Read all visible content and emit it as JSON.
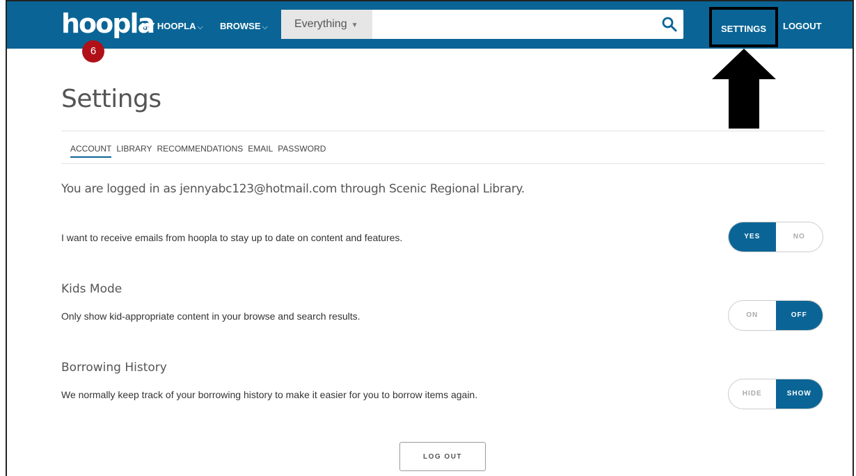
{
  "header": {
    "logo": "hoopla",
    "badge_count": "6",
    "my_hoopla": "MY HOOPLA",
    "browse": "BROWSE",
    "search": {
      "filter": "Everything",
      "placeholder": ""
    },
    "settings": "SETTINGS",
    "logout": "LOGOUT"
  },
  "page": {
    "title": "Settings",
    "tabs": [
      {
        "label": "ACCOUNT",
        "active": true
      },
      {
        "label": "LIBRARY"
      },
      {
        "label": "RECOMMENDATIONS"
      },
      {
        "label": "EMAIL"
      },
      {
        "label": "PASSWORD"
      }
    ],
    "login_text": "You are logged in as jennyabc123@hotmail.com through Scenic Regional Library.",
    "emails": {
      "text": "I want to receive emails from hoopla to stay up to date on content and features.",
      "options": [
        "YES",
        "NO"
      ],
      "selected": "YES"
    },
    "kids_mode": {
      "title": "Kids Mode",
      "text": "Only show kid-appropriate content in your browse and search results.",
      "options": [
        "ON",
        "OFF"
      ],
      "selected": "OFF"
    },
    "history": {
      "title": "Borrowing History",
      "text": "We normally keep track of your borrowing history to make it easier for you to borrow items again.",
      "options": [
        "HIDE",
        "SHOW"
      ],
      "selected": "SHOW"
    },
    "log_out_button": "LOG OUT"
  },
  "colors": {
    "brand": "#0a6596",
    "badge": "#b01018"
  }
}
